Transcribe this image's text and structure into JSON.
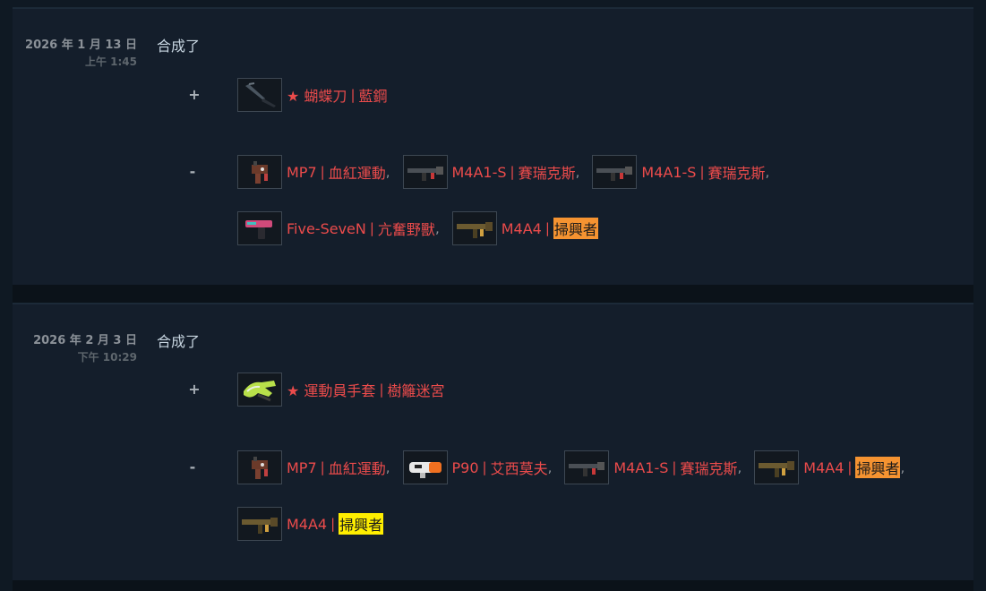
{
  "entries": [
    {
      "date": "2026 年 1 月 13 日",
      "time": "上午 1:45",
      "action": "合成了",
      "plus_sign": "+",
      "minus_sign": "-",
      "received": {
        "weapon": "★ 蝴蝶刀",
        "skin": "藍鋼",
        "icon": "butterfly-knife-icon"
      },
      "consumed_row1": [
        {
          "weapon": "MP7",
          "skin": "血紅運動",
          "icon": "mp7-icon"
        },
        {
          "weapon": "M4A1-S",
          "skin": "賽瑞克斯",
          "icon": "m4a1s-icon"
        },
        {
          "weapon": "M4A1-S",
          "skin": "賽瑞克斯",
          "icon": "m4a1s-icon"
        }
      ],
      "consumed_row2": [
        {
          "weapon": "Five-SeveN",
          "skin": "亢奮野獸",
          "icon": "five-seven-icon"
        },
        {
          "weapon": "M4A4",
          "skin": "掃興者",
          "icon": "m4a4-icon",
          "highlight": "#f59331"
        }
      ]
    },
    {
      "date": "2026 年 2 月 3 日",
      "time": "下午 10:29",
      "action": "合成了",
      "plus_sign": "+",
      "minus_sign": "-",
      "received": {
        "weapon": "★ 運動員手套",
        "skin": "樹籬迷宮",
        "icon": "sport-gloves-icon"
      },
      "consumed_row1": [
        {
          "weapon": "MP7",
          "skin": "血紅運動",
          "icon": "mp7-icon"
        },
        {
          "weapon": "P90",
          "skin": "艾西莫夫",
          "icon": "p90-icon"
        },
        {
          "weapon": "M4A1-S",
          "skin": "賽瑞克斯",
          "icon": "m4a1s-icon"
        },
        {
          "weapon": "M4A4",
          "skin": "掃興者",
          "icon": "m4a4-icon",
          "highlight": "#f59331"
        }
      ],
      "consumed_row2": [
        {
          "weapon": "M4A4",
          "skin": "掃興者",
          "icon": "m4a4-icon",
          "highlight": "#ffee00"
        }
      ]
    }
  ],
  "separator": "|",
  "comma": ",",
  "colors": {
    "item_name": "#eb4b4b",
    "highlight_orange": "#f59331",
    "highlight_yellow": "#ffee00",
    "entry_bg": "#141e2b",
    "page_bg": "#0f1923"
  }
}
